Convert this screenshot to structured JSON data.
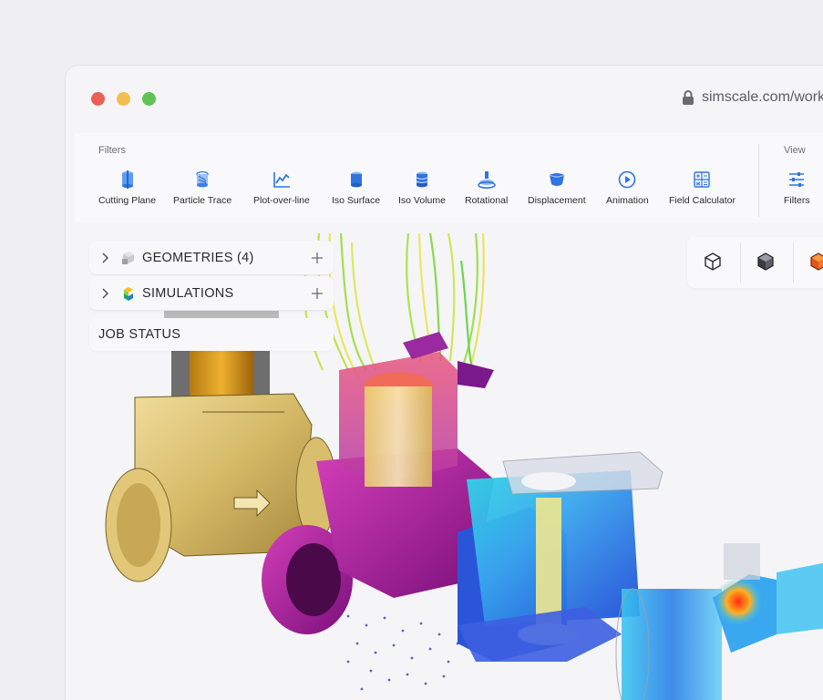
{
  "window": {
    "url": "simscale.com/workbench"
  },
  "toolbar": {
    "filters_label": "Filters",
    "view_label": "View",
    "tools": [
      {
        "label": "Cutting Plane",
        "icon": "cutting-plane-icon"
      },
      {
        "label": "Particle Trace",
        "icon": "particle-trace-icon"
      },
      {
        "label": "Plot-over-line",
        "icon": "plot-over-line-icon"
      },
      {
        "label": "Iso Surface",
        "icon": "iso-surface-icon"
      },
      {
        "label": "Iso Volume",
        "icon": "iso-volume-icon"
      },
      {
        "label": "Rotational",
        "icon": "rotational-icon"
      },
      {
        "label": "Displacement",
        "icon": "displacement-icon"
      },
      {
        "label": "Animation",
        "icon": "animation-icon"
      },
      {
        "label": "Field Calculator",
        "icon": "field-calculator-icon"
      }
    ],
    "view_tools": [
      {
        "label": "Filters",
        "icon": "sliders-icon"
      }
    ]
  },
  "tree": {
    "items": [
      {
        "label": "GEOMETRIES (4)",
        "icon": "geometries-icon"
      },
      {
        "label": "SIMULATIONS",
        "icon": "simulations-icon"
      }
    ],
    "job_status": "JOB STATUS"
  },
  "colors": {
    "accent": "#1f6fe5",
    "traffic_red": "#ec5f57",
    "traffic_yellow": "#f4be4f",
    "traffic_green": "#5fc454"
  }
}
